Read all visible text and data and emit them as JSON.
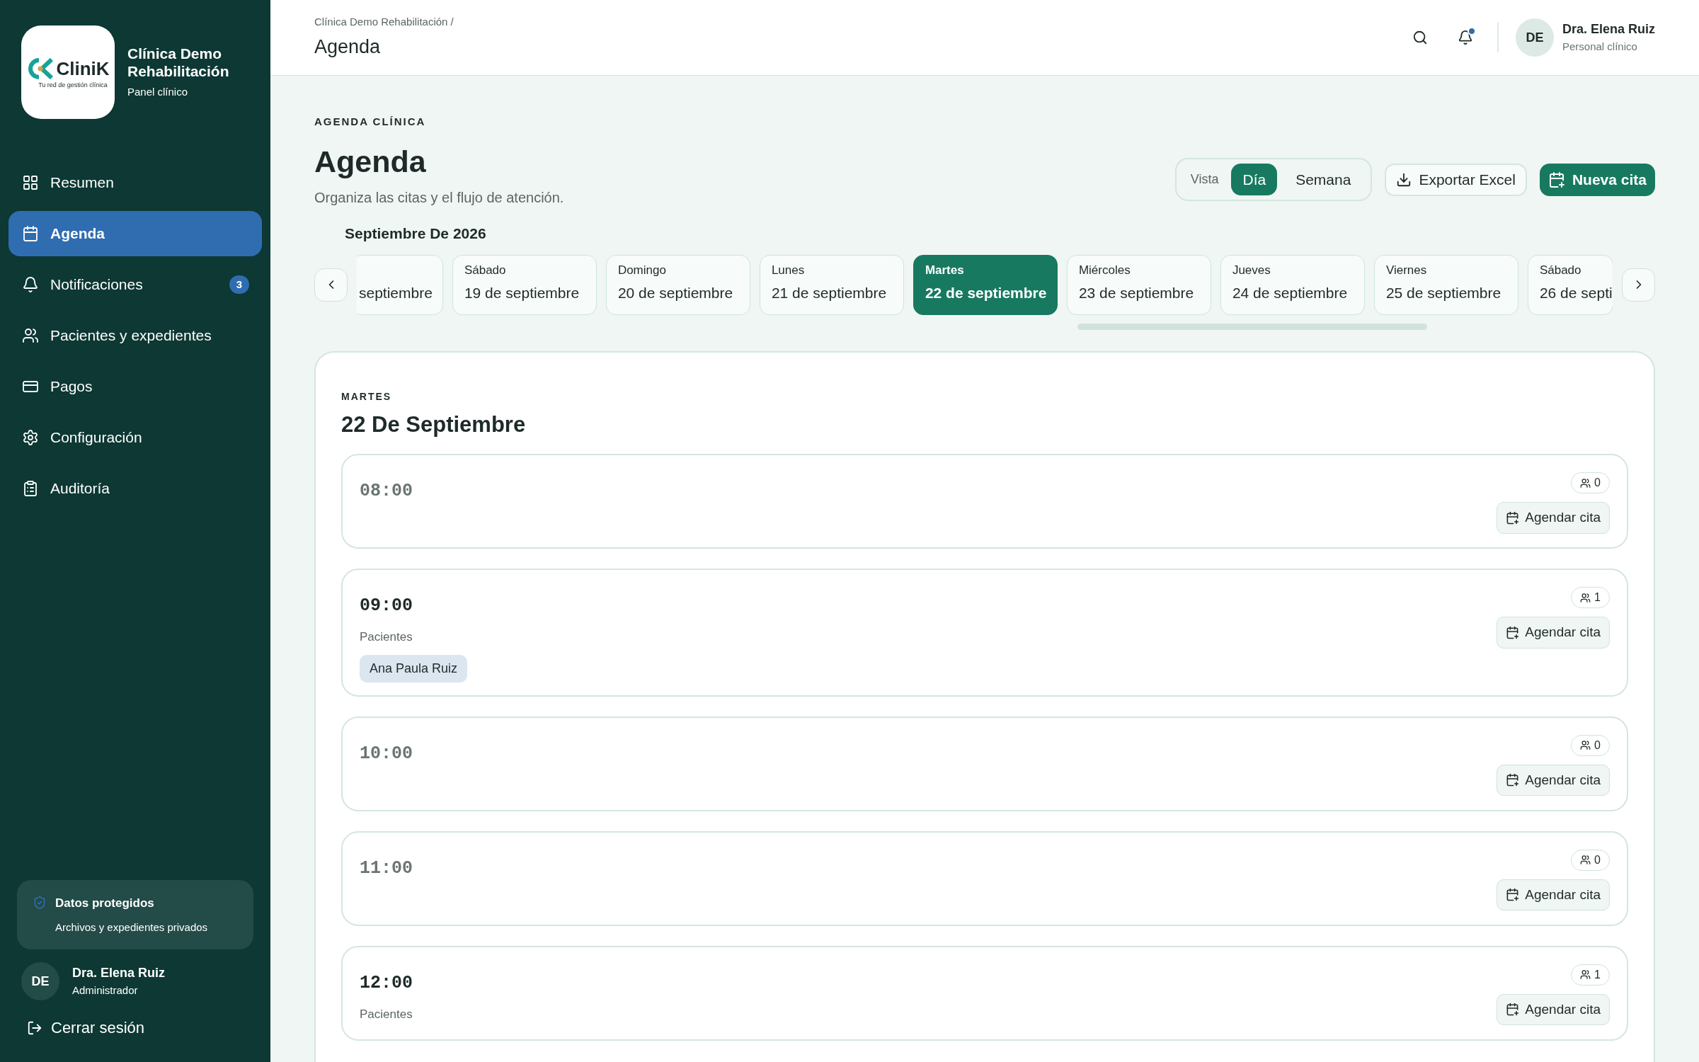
{
  "sidebar": {
    "logo": {
      "name": "CliniK",
      "tagline": "Tu red de gestión clínica"
    },
    "clinic_name": "Clínica Demo Rehabilitación",
    "subtitle": "Panel clínico",
    "items": [
      {
        "kind": "grid",
        "label": "Resumen",
        "selected": false
      },
      {
        "kind": "calendar",
        "label": "Agenda",
        "selected": true
      },
      {
        "kind": "bell",
        "label": "Notificaciones",
        "selected": false,
        "badge": "3"
      },
      {
        "kind": "users",
        "label": "Pacientes y expedientes",
        "selected": false
      },
      {
        "kind": "card",
        "label": "Pagos",
        "selected": false
      },
      {
        "kind": "gear",
        "label": "Configuración",
        "selected": false
      },
      {
        "kind": "clipboard",
        "label": "Auditoría",
        "selected": false
      }
    ],
    "security": {
      "title": "Datos protegidos",
      "text": "Archivos y expedientes privados"
    },
    "user": {
      "initials": "DE",
      "name": "Dra. Elena Ruiz",
      "role": "Administrador"
    },
    "logout": "Cerrar sesión"
  },
  "header": {
    "breadcrumb": "Clínica Demo Rehabilitación /",
    "title": "Agenda",
    "notifications_unread": true,
    "user": {
      "initials": "DE",
      "name": "Dra. Elena Ruiz",
      "role": "Personal clínico"
    }
  },
  "page": {
    "eyebrow": "AGENDA CLÍNICA",
    "title": "Agenda",
    "subtitle": "Organiza las citas y el flujo de atención.",
    "view_label": "Vista",
    "views": [
      {
        "label": "Día",
        "selected": true
      },
      {
        "label": "Semana",
        "selected": false
      }
    ],
    "export_button": "Exportar Excel",
    "new_button": "Nueva cita"
  },
  "date_strip": {
    "month": "Septiembre De 2026",
    "days": [
      {
        "date": "septiembre",
        "selected": false
      },
      {
        "day": "Sábado",
        "date": "19 de septiembre",
        "selected": false
      },
      {
        "day": "Domingo",
        "date": "20 de septiembre",
        "selected": false
      },
      {
        "day": "Lunes",
        "date": "21 de septiembre",
        "selected": false
      },
      {
        "day": "Martes",
        "date": "22 de septiembre",
        "selected": true
      },
      {
        "day": "Miércoles",
        "date": "23 de septiembre",
        "selected": false
      },
      {
        "day": "Jueves",
        "date": "24 de septiembre",
        "selected": false
      },
      {
        "day": "Viernes",
        "date": "25 de septiembre",
        "selected": false
      },
      {
        "day": "Sábado",
        "date": "26 de septi",
        "selected": false
      }
    ]
  },
  "day_panel": {
    "weekday": "MARTES",
    "date": "22 De Septiembre",
    "slots": [
      {
        "time": "08:00",
        "count": "0",
        "action": "Agendar cita"
      },
      {
        "time": "09:00",
        "count": "1",
        "action": "Agendar cita",
        "patients_heading": "Pacientes",
        "patients": [
          "Ana Paula Ruiz"
        ]
      },
      {
        "time": "10:00",
        "count": "0",
        "action": "Agendar cita"
      },
      {
        "time": "11:00",
        "count": "0",
        "action": "Agendar cita"
      },
      {
        "time": "12:00",
        "count": "1",
        "action": "Agendar cita",
        "patients_heading": "Pacientes"
      }
    ]
  }
}
